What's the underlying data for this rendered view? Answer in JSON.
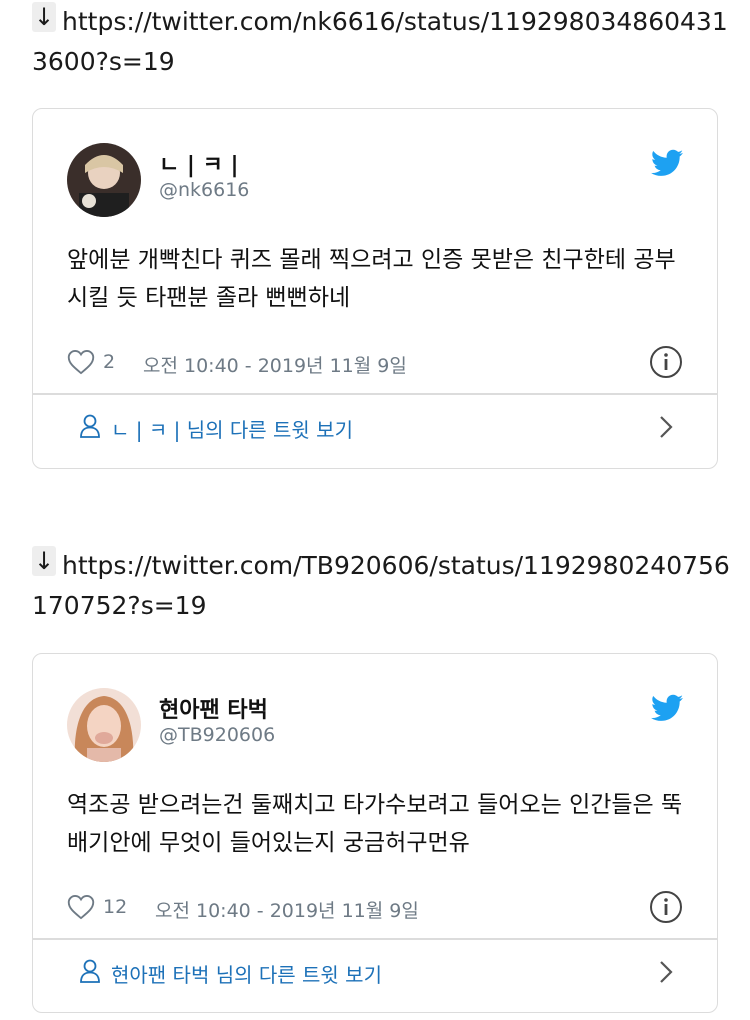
{
  "links": [
    {
      "arrow": "↓",
      "url": "https://twitter.com/nk6616/status/1192980348604313600?s=19"
    },
    {
      "arrow": "↓",
      "url": "https://twitter.com/TB920606/status/1192980240756170752?s=19"
    }
  ],
  "tweets": [
    {
      "name": "ㄴ | ㅋ |",
      "handle": "@nk6616",
      "text": "앞에분 개빡친다 퀴즈 몰래 찍으려고 인증 못받은 친구한테 공부시킬 듯 타팬분 졸라 뻔뻔하네",
      "likes": "2",
      "timestamp": "오전 10:40 - 2019년 11월 9일",
      "more_link": "ㄴ | ㅋ | 님의 다른 트윗 보기"
    },
    {
      "name": "현아팬 타벅",
      "handle": "@TB920606",
      "text": "역조공 받으려는건 둘째치고 타가수보려고 들어오는 인간들은 뚝배기안에 무엇이 들어있는지 궁금허구먼유",
      "likes": "12",
      "timestamp": "오전 10:40 - 2019년 11월 9일",
      "more_link": "현아팬 타벅 님의 다른 트윗 보기"
    }
  ],
  "colors": {
    "link_blue": "#1d71b8",
    "twitter_blue": "#1da1f2",
    "muted": "#6e7a85"
  },
  "icons": [
    "down-arrow-icon",
    "twitter-bird-icon",
    "heart-icon",
    "info-icon",
    "person-icon",
    "chevron-right-icon"
  ]
}
